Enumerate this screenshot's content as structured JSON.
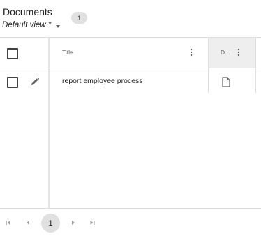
{
  "header": {
    "title": "Documents",
    "count_badge": "1",
    "view_label": "Default view *"
  },
  "table": {
    "columns": [
      {
        "label": "Title"
      },
      {
        "label": "D..."
      }
    ],
    "rows": [
      {
        "title": "report employee process",
        "doc_icon": "file-icon"
      }
    ]
  },
  "pagination": {
    "current_page": "1"
  },
  "colors": {
    "badge_bg": "#e0e0e0",
    "highlight_col_bg": "#eeeeee",
    "border": "#e0e0e0"
  }
}
